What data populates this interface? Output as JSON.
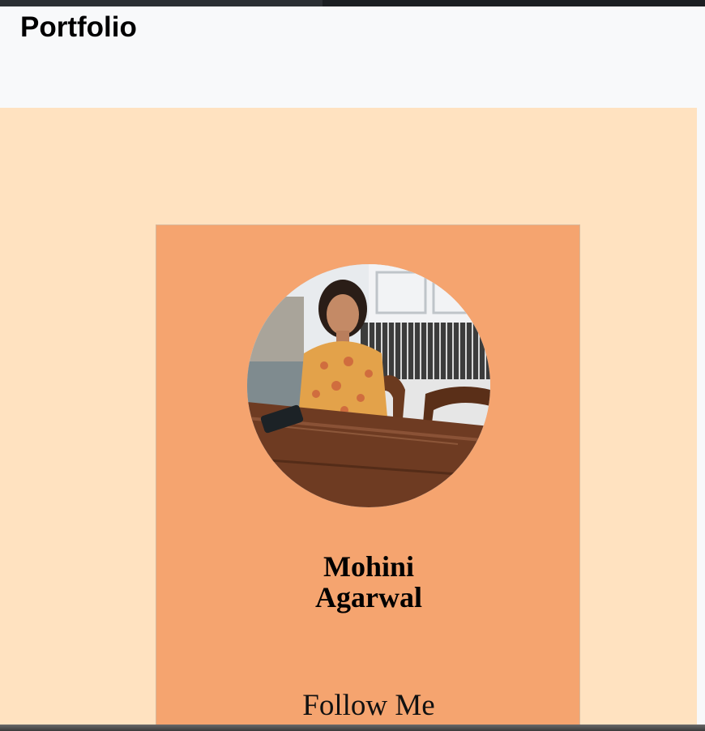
{
  "navbar": {
    "brand": "Portfolio"
  },
  "profile": {
    "photo_icon": "profile-photo",
    "first_name": "Mohini",
    "last_name": "Agarwal",
    "follow_label": "Follow Me"
  },
  "colors": {
    "navbar_bg": "#f8f9fa",
    "hero_bg": "#ffe2c0",
    "card_bg": "#f5a46f"
  }
}
